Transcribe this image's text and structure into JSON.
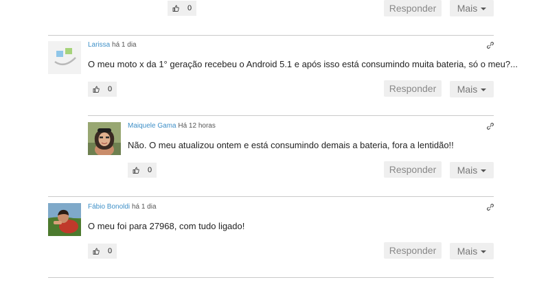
{
  "comments": [
    {
      "like_count": "0",
      "reply_label": "Responder",
      "more_label": "Mais"
    },
    {
      "author": "Larissa",
      "time": "há 1 dia",
      "text": "O meu moto x da 1° geração recebeu o Android 5.1 e após isso está consumindo muita bateria, só o meu?...",
      "like_count": "0",
      "reply_label": "Responder",
      "more_label": "Mais",
      "avatar_icon": "default-avatar-icon"
    },
    {
      "author": "Maiquele Gama",
      "time": "Há 12 horas",
      "text": "Não. O meu atualizou ontem e está consumindo demais a bateria, fora a lentidão!!",
      "like_count": "0",
      "reply_label": "Responder",
      "more_label": "Mais",
      "avatar_icon": "user-photo-avatar"
    },
    {
      "author": "Fábio Bonoldi",
      "time": "há 1 dia",
      "text": "O meu foi para 27968, com tudo ligado!",
      "like_count": "0",
      "reply_label": "Responder",
      "more_label": "Mais",
      "avatar_icon": "user-photo-avatar"
    }
  ],
  "colors": {
    "author_link": "#3d8fc7",
    "button_bg": "#efefef",
    "separator": "#c9c9c9"
  },
  "icons": {
    "like": "thumbs-up-icon",
    "permalink": "link-icon",
    "dropdown": "caret-down-icon"
  }
}
